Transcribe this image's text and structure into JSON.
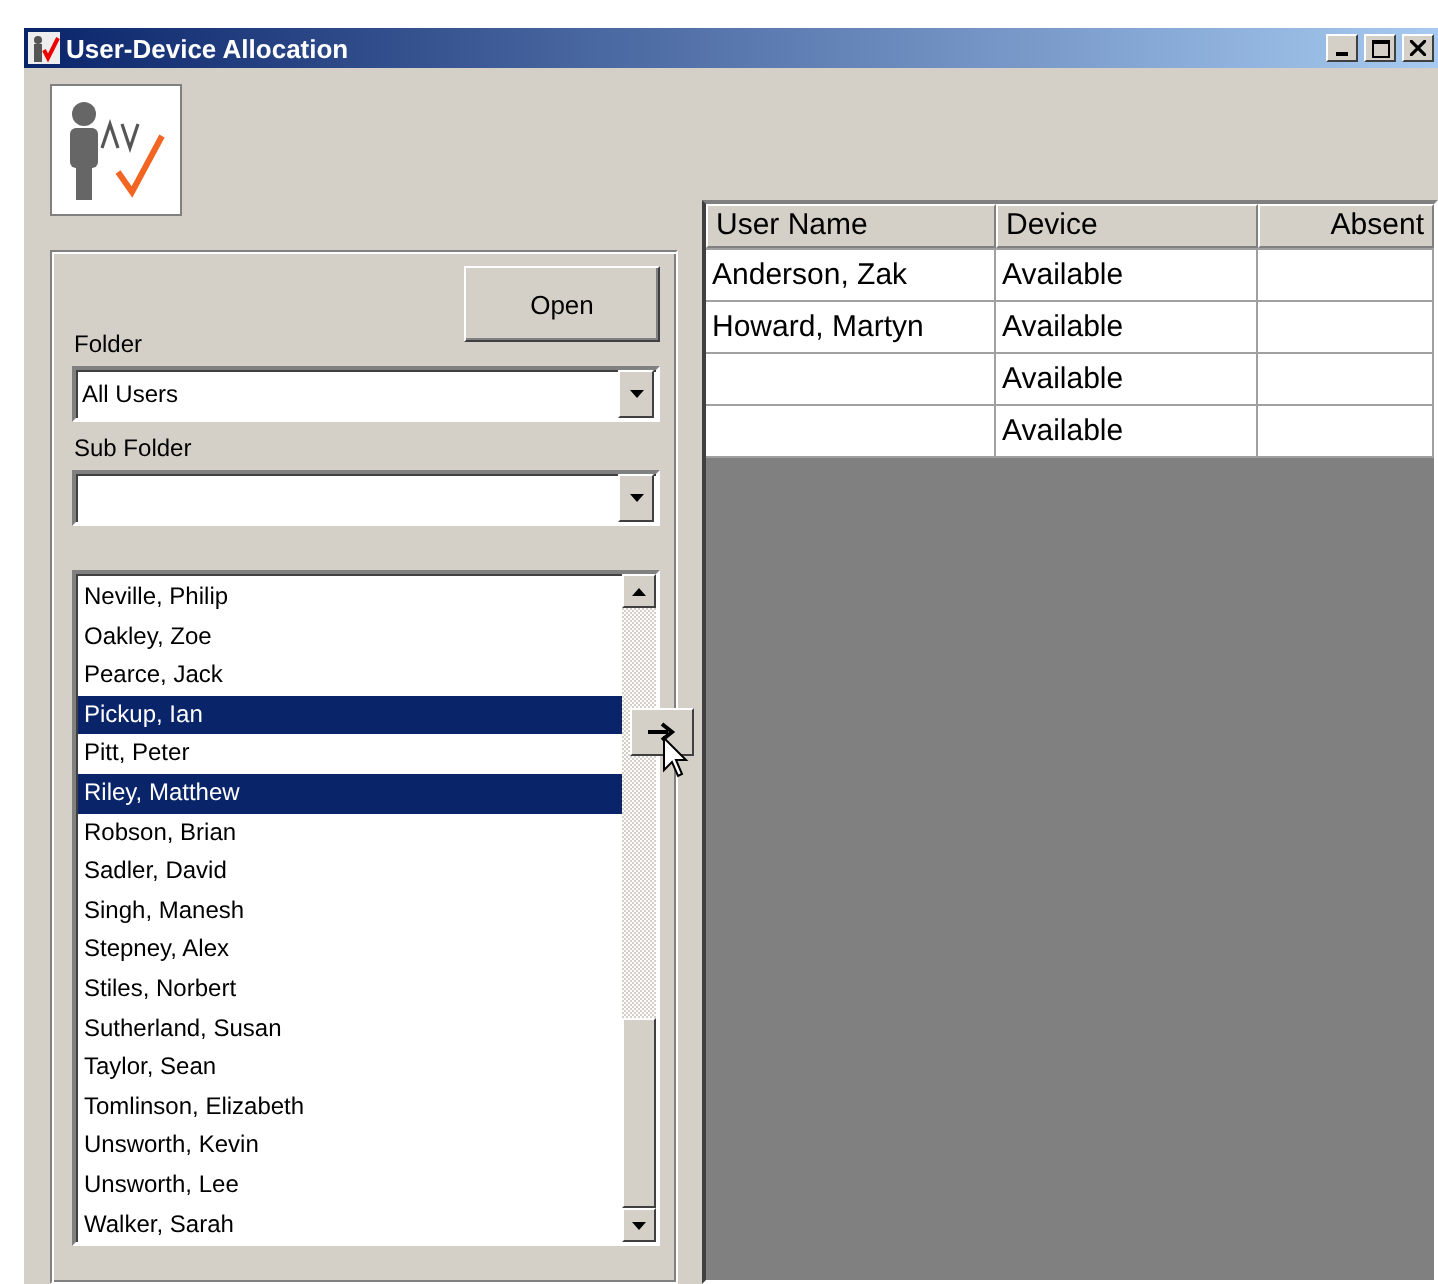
{
  "window": {
    "title": "User-Device Allocation",
    "controls": [
      {
        "kind": "minimize"
      },
      {
        "kind": "maximize"
      },
      {
        "kind": "close"
      }
    ]
  },
  "open_button": "Open",
  "folder": {
    "label": "Folder",
    "value": "All Users"
  },
  "sub_folder": {
    "label": "Sub Folder"
  },
  "users": [
    {
      "name": "Neville, Philip",
      "selected": false
    },
    {
      "name": "Oakley, Zoe",
      "selected": false
    },
    {
      "name": "Pearce, Jack",
      "selected": false
    },
    {
      "name": "Pickup, Ian",
      "selected": true
    },
    {
      "name": "Pitt, Peter",
      "selected": false
    },
    {
      "name": "Riley, Matthew",
      "selected": true
    },
    {
      "name": "Robson, Brian",
      "selected": false
    },
    {
      "name": "Sadler, David",
      "selected": false
    },
    {
      "name": "Singh, Manesh",
      "selected": false
    },
    {
      "name": "Stepney, Alex",
      "selected": false
    },
    {
      "name": "Stiles, Norbert",
      "selected": false
    },
    {
      "name": "Sutherland, Susan",
      "selected": false
    },
    {
      "name": "Taylor, Sean",
      "selected": false
    },
    {
      "name": "Tomlinson, Elizabeth",
      "selected": false
    },
    {
      "name": "Unsworth, Kevin",
      "selected": false
    },
    {
      "name": "Unsworth, Lee",
      "selected": false
    },
    {
      "name": "Walker, Sarah",
      "selected": false
    }
  ],
  "table": {
    "columns": [
      "User Name",
      "Device",
      "Absent"
    ],
    "rows": [
      {
        "user_name": "Anderson, Zak",
        "device": "Available"
      },
      {
        "user_name": "Howard, Martyn",
        "device": "Available"
      },
      {
        "device": "Available"
      },
      {
        "device": "Available"
      }
    ]
  }
}
